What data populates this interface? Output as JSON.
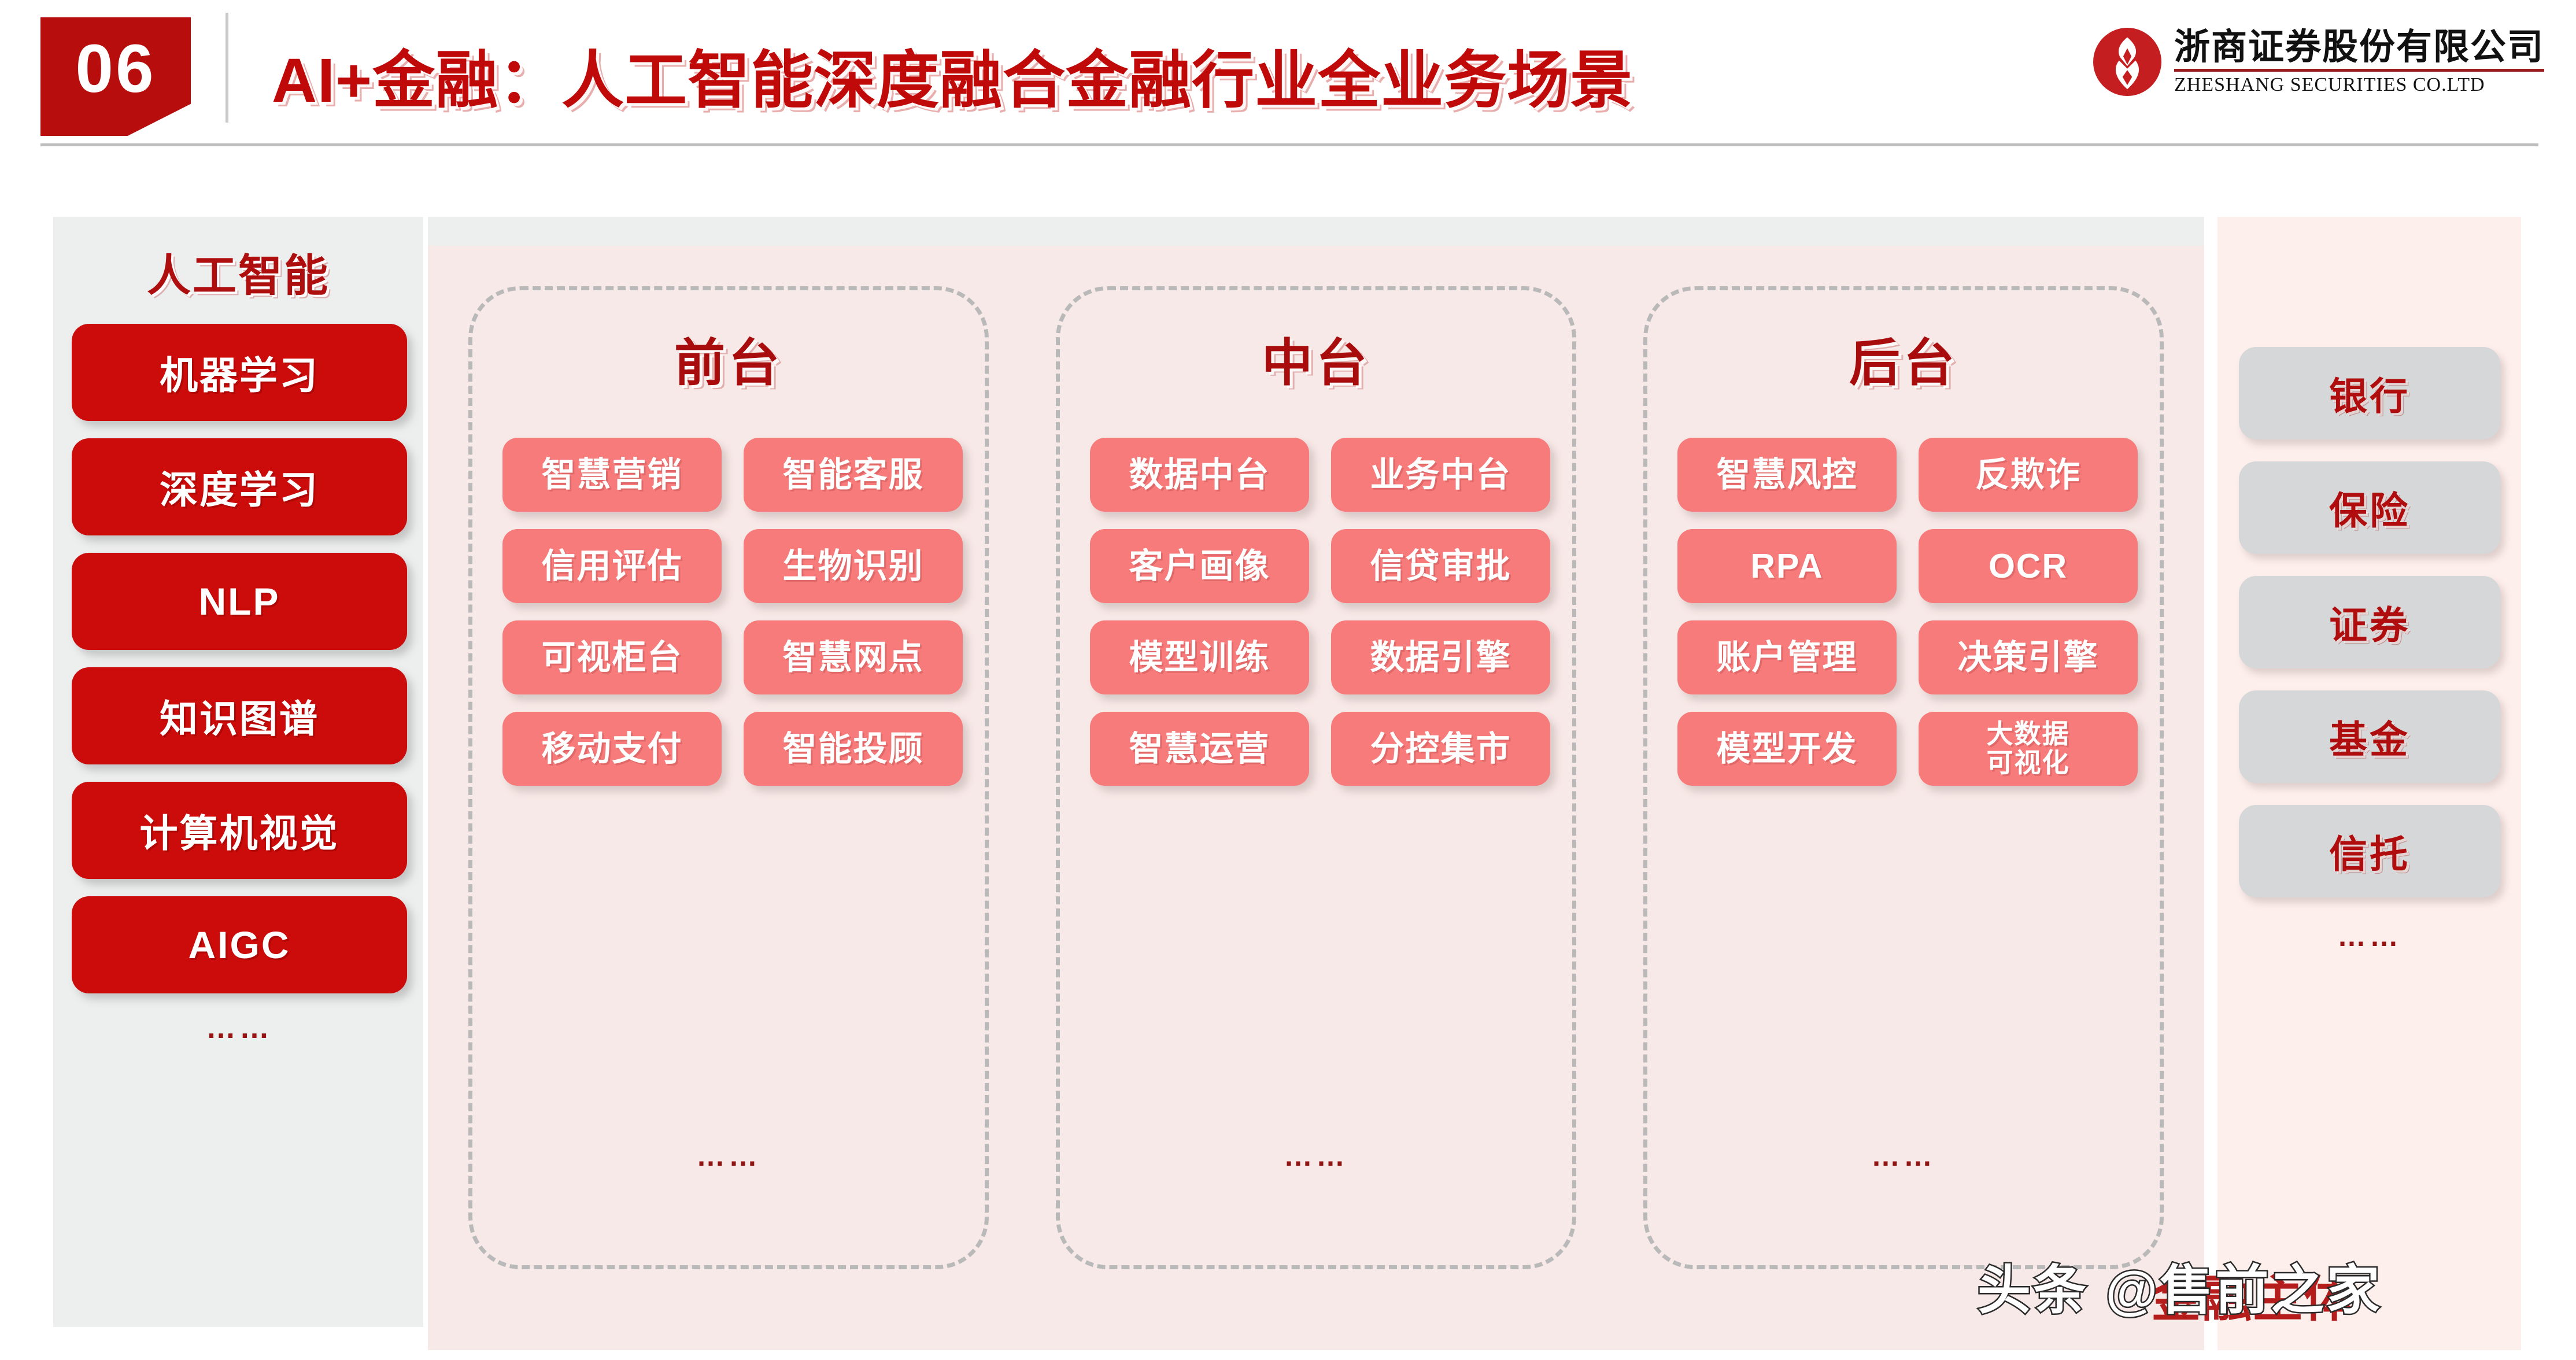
{
  "header": {
    "section_number": "06",
    "title": "AI+金融：人工智能深度融合金融行业全业务场景",
    "logo": {
      "cn": "浙商证券股份有限公司",
      "en": "ZHESHANG SECURITIES CO.LTD"
    }
  },
  "ai_sidebar": {
    "heading": "人工智能",
    "items": [
      {
        "label": "机器学习"
      },
      {
        "label": "深度学习"
      },
      {
        "label": "NLP"
      },
      {
        "label": "知识图谱"
      },
      {
        "label": "计算机视觉"
      },
      {
        "label": "AIGC"
      }
    ],
    "more": "……"
  },
  "columns": [
    {
      "title": "前台",
      "more": "……",
      "tiles": [
        {
          "label": "智慧营销"
        },
        {
          "label": "智能客服"
        },
        {
          "label": "信用评估"
        },
        {
          "label": "生物识别"
        },
        {
          "label": "可视柜台"
        },
        {
          "label": "智慧网点"
        },
        {
          "label": "移动支付"
        },
        {
          "label": "智能投顾"
        }
      ]
    },
    {
      "title": "中台",
      "more": "……",
      "tiles": [
        {
          "label": "数据中台"
        },
        {
          "label": "业务中台"
        },
        {
          "label": "客户画像"
        },
        {
          "label": "信贷审批"
        },
        {
          "label": "模型训练"
        },
        {
          "label": "数据引擎"
        },
        {
          "label": "智慧运营"
        },
        {
          "label": "分控集市"
        }
      ]
    },
    {
      "title": "后台",
      "more": "……",
      "tiles": [
        {
          "label": "智慧风控"
        },
        {
          "label": "反欺诈"
        },
        {
          "label": "RPA"
        },
        {
          "label": "OCR"
        },
        {
          "label": "账户管理"
        },
        {
          "label": "决策引擎"
        },
        {
          "label": "模型开发"
        },
        {
          "label": "大数据\n可视化",
          "two_line": true
        }
      ]
    }
  ],
  "sectors": {
    "items": [
      {
        "label": "银行"
      },
      {
        "label": "保险"
      },
      {
        "label": "证券"
      },
      {
        "label": "基金"
      },
      {
        "label": "信托"
      }
    ],
    "more": "……"
  },
  "watermark": {
    "text": "头条 @售前之家",
    "underlay": "金融主体"
  },
  "colors": {
    "brand_red": "#C00A0A",
    "deep_red": "#AE0E0E",
    "pill_red": "#CC0B0B",
    "tile_salmon": "#F87B7B",
    "sector_gray": "#D5D7D8",
    "panel_gray": "#EDEEEE",
    "panel_pink": "#F7E9E7",
    "panel_pink_light": "#FDEFEC",
    "dashed_border": "#B9B9B9"
  }
}
